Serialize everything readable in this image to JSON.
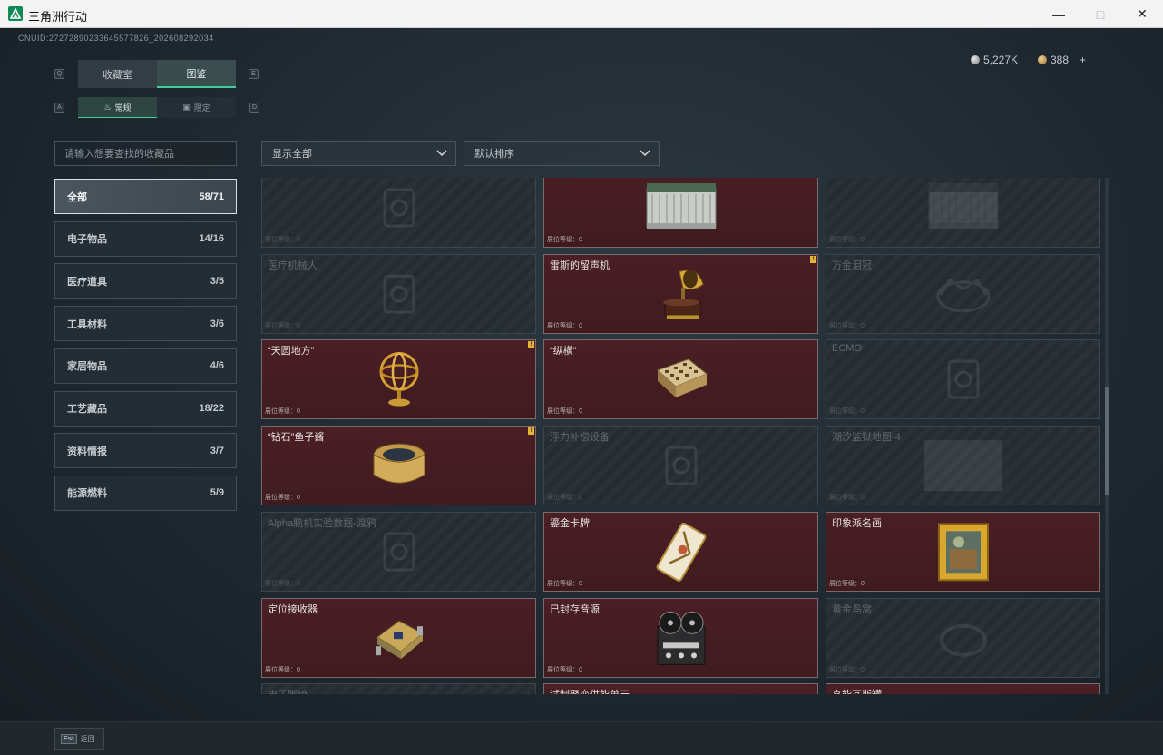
{
  "window": {
    "title": "三角洲行动"
  },
  "header": {
    "uid": "CNUID:27272890233645577826_202608292034",
    "currency": [
      {
        "value": "5,227K",
        "icon": "silver-coin-icon"
      },
      {
        "value": "388",
        "icon": "gold-coin-icon",
        "plus": "+"
      }
    ]
  },
  "tabs": [
    {
      "label": "收藏室"
    },
    {
      "label": "图鉴"
    }
  ],
  "subtabs": [
    {
      "label": "常规",
      "icon": "flame-icon"
    },
    {
      "label": "限定",
      "icon": "frame-icon"
    }
  ],
  "keyhints": {
    "tab_left": "Q",
    "tab_right": "E",
    "sub_left": "A",
    "sub_right": "D"
  },
  "search": {
    "placeholder": "请输入想要查找的收藏品"
  },
  "filters": {
    "show": "显示全部",
    "sort": "默认排序"
  },
  "categories": [
    {
      "label": "全部",
      "count": "58/71"
    },
    {
      "label": "电子物品",
      "count": "14/16"
    },
    {
      "label": "医疗道具",
      "count": "3/5"
    },
    {
      "label": "工具材料",
      "count": "3/6"
    },
    {
      "label": "家居物品",
      "count": "4/6"
    },
    {
      "label": "工艺藏品",
      "count": "18/22"
    },
    {
      "label": "资料情报",
      "count": "3/7"
    },
    {
      "label": "能源燃料",
      "count": "5/9"
    }
  ],
  "items": [
    {
      "name": "",
      "level": "展位等级：0",
      "owned": false,
      "badge": false,
      "art": "device"
    },
    {
      "name": "",
      "level": "展位等级：0",
      "owned": true,
      "badge": false,
      "art": "crate"
    },
    {
      "name": "",
      "level": "展位等级：0",
      "owned": false,
      "badge": false,
      "art": "crate"
    },
    {
      "name": "医疗机械人",
      "level": "展位等级：0",
      "owned": false,
      "badge": false,
      "art": "device"
    },
    {
      "name": "雷斯的留声机",
      "level": "展位等级：0",
      "owned": true,
      "badge": true,
      "art": "gramophone"
    },
    {
      "name": "万金泪冠",
      "level": "展位等级：0",
      "owned": false,
      "badge": false,
      "art": "crown"
    },
    {
      "name": "“天圆地方”",
      "level": "展位等级：0",
      "owned": true,
      "badge": true,
      "art": "armillary"
    },
    {
      "name": "“纵横”",
      "level": "展位等级：0",
      "owned": true,
      "badge": false,
      "art": "chess"
    },
    {
      "name": "ECMO",
      "level": "展位等级：0",
      "owned": false,
      "badge": false,
      "art": "device"
    },
    {
      "name": "“钻石”鱼子酱",
      "level": "展位等级：0",
      "owned": true,
      "badge": true,
      "art": "caviar"
    },
    {
      "name": "浮力补偿设备",
      "level": "展位等级：0",
      "owned": false,
      "badge": false,
      "art": "device"
    },
    {
      "name": "潮汐监狱地图-4",
      "level": "展位等级：0",
      "owned": false,
      "badge": false,
      "art": "map"
    },
    {
      "name": "Alpha脑机实验数据-渡鸦",
      "level": "展位等级：0",
      "owned": false,
      "badge": false,
      "art": "device"
    },
    {
      "name": "鎏金卡牌",
      "level": "展位等级：0",
      "owned": true,
      "badge": false,
      "art": "card"
    },
    {
      "name": "印象派名画",
      "level": "展位等级：0",
      "owned": true,
      "badge": false,
      "art": "painting"
    },
    {
      "name": "定位接收器",
      "level": "展位等级：0",
      "owned": true,
      "badge": false,
      "art": "receiver"
    },
    {
      "name": "已封存音源",
      "level": "展位等级：0",
      "owned": true,
      "badge": false,
      "art": "reel"
    },
    {
      "name": "黄金鸟窝",
      "level": "展位等级：0",
      "owned": false,
      "badge": false,
      "art": "nest"
    },
    {
      "name": "电子脚镣",
      "level": "",
      "owned": false,
      "badge": false,
      "art": "none"
    },
    {
      "name": "试制聚变供能单元",
      "level": "",
      "owned": true,
      "badge": false,
      "art": "none"
    },
    {
      "name": "高能瓦斯罐",
      "level": "",
      "owned": true,
      "badge": false,
      "art": "none"
    }
  ],
  "footer": {
    "key": "Esc",
    "label": "返回"
  }
}
